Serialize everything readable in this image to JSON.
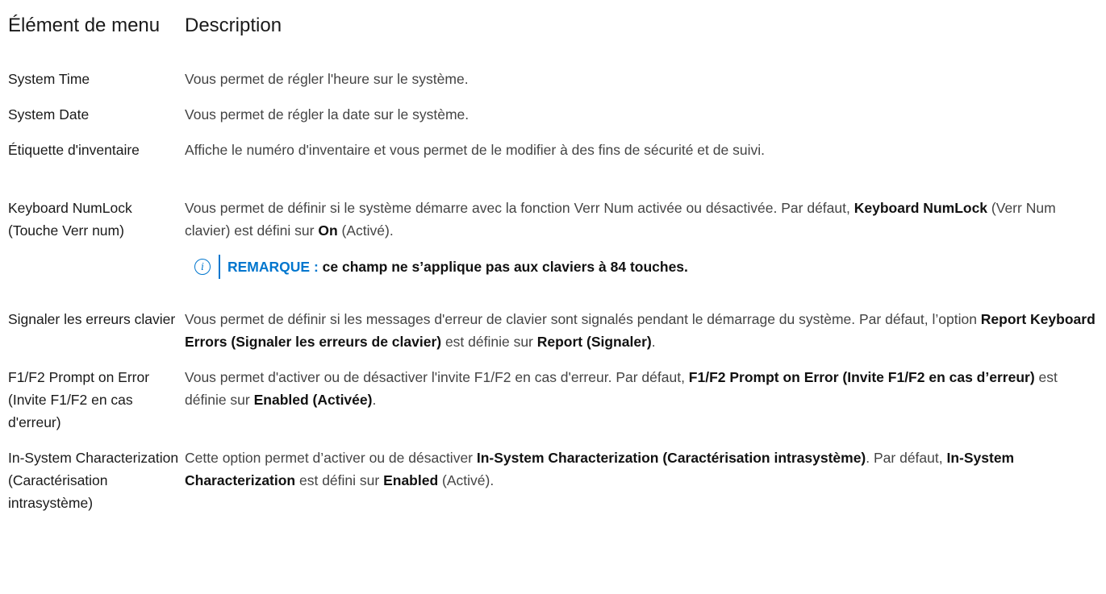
{
  "header": {
    "item_label": "Élément de menu",
    "desc_label": "Description"
  },
  "rows": [
    {
      "item": "System Time",
      "desc": "Vous permet de régler l'heure sur le système."
    },
    {
      "item": "System Date",
      "desc": "Vous permet de régler la date sur le système."
    },
    {
      "item": "Étiquette d'inventaire",
      "desc": "Affiche le numéro d'inventaire et vous permet de le modifier à des fins de sécurité et de suivi."
    },
    {
      "item": "Keyboard NumLock (Touche Verr num)",
      "desc_1": "Vous permet de définir si le système démarre avec la fonction Verr Num activée ou désactivée. Par défaut, ",
      "desc_b1": "Keyboard NumLock",
      "desc_2": " (Verr Num clavier) est défini sur ",
      "desc_b2": "On",
      "desc_3": " (Activé).",
      "note_label": "REMARQUE :",
      "note_text": " ce champ ne s’applique pas aux claviers à 84 touches."
    },
    {
      "item": "Signaler les erreurs clavier",
      "desc_1": "Vous permet de définir si les messages d'erreur de clavier sont signalés pendant le démarrage du système. Par défaut, l’option ",
      "desc_b1": "Report Keyboard Errors (Signaler les erreurs de clavier)",
      "desc_2": " est définie sur ",
      "desc_b2": "Report (Signaler)",
      "desc_3": "."
    },
    {
      "item": "F1/F2 Prompt on Error (Invite F1/F2 en cas d'erreur)",
      "desc_1": "Vous permet d'activer ou de désactiver l'invite F1/F2 en cas d'erreur. Par défaut, ",
      "desc_b1": "F1/F2 Prompt on Error (Invite F1/F2 en cas d’erreur)",
      "desc_2": " est définie sur ",
      "desc_b2": "Enabled (Activée)",
      "desc_3": "."
    },
    {
      "item": "In-System Characterization (Caractérisation intrasystème)",
      "desc_1": "Cette option permet d’activer ou de désactiver ",
      "desc_b1": "In-System Characterization (Caractérisation intrasystème)",
      "desc_2": ". Par défaut, ",
      "desc_b2": "In-System Characterization",
      "desc_3": " est défini sur ",
      "desc_b3": "Enabled",
      "desc_4": " (Activé)."
    }
  ],
  "colors": {
    "accent": "#0076ce",
    "text": "#1a1a1a",
    "desc_text": "#444444"
  },
  "icons": {
    "note": "info-circle-icon"
  }
}
